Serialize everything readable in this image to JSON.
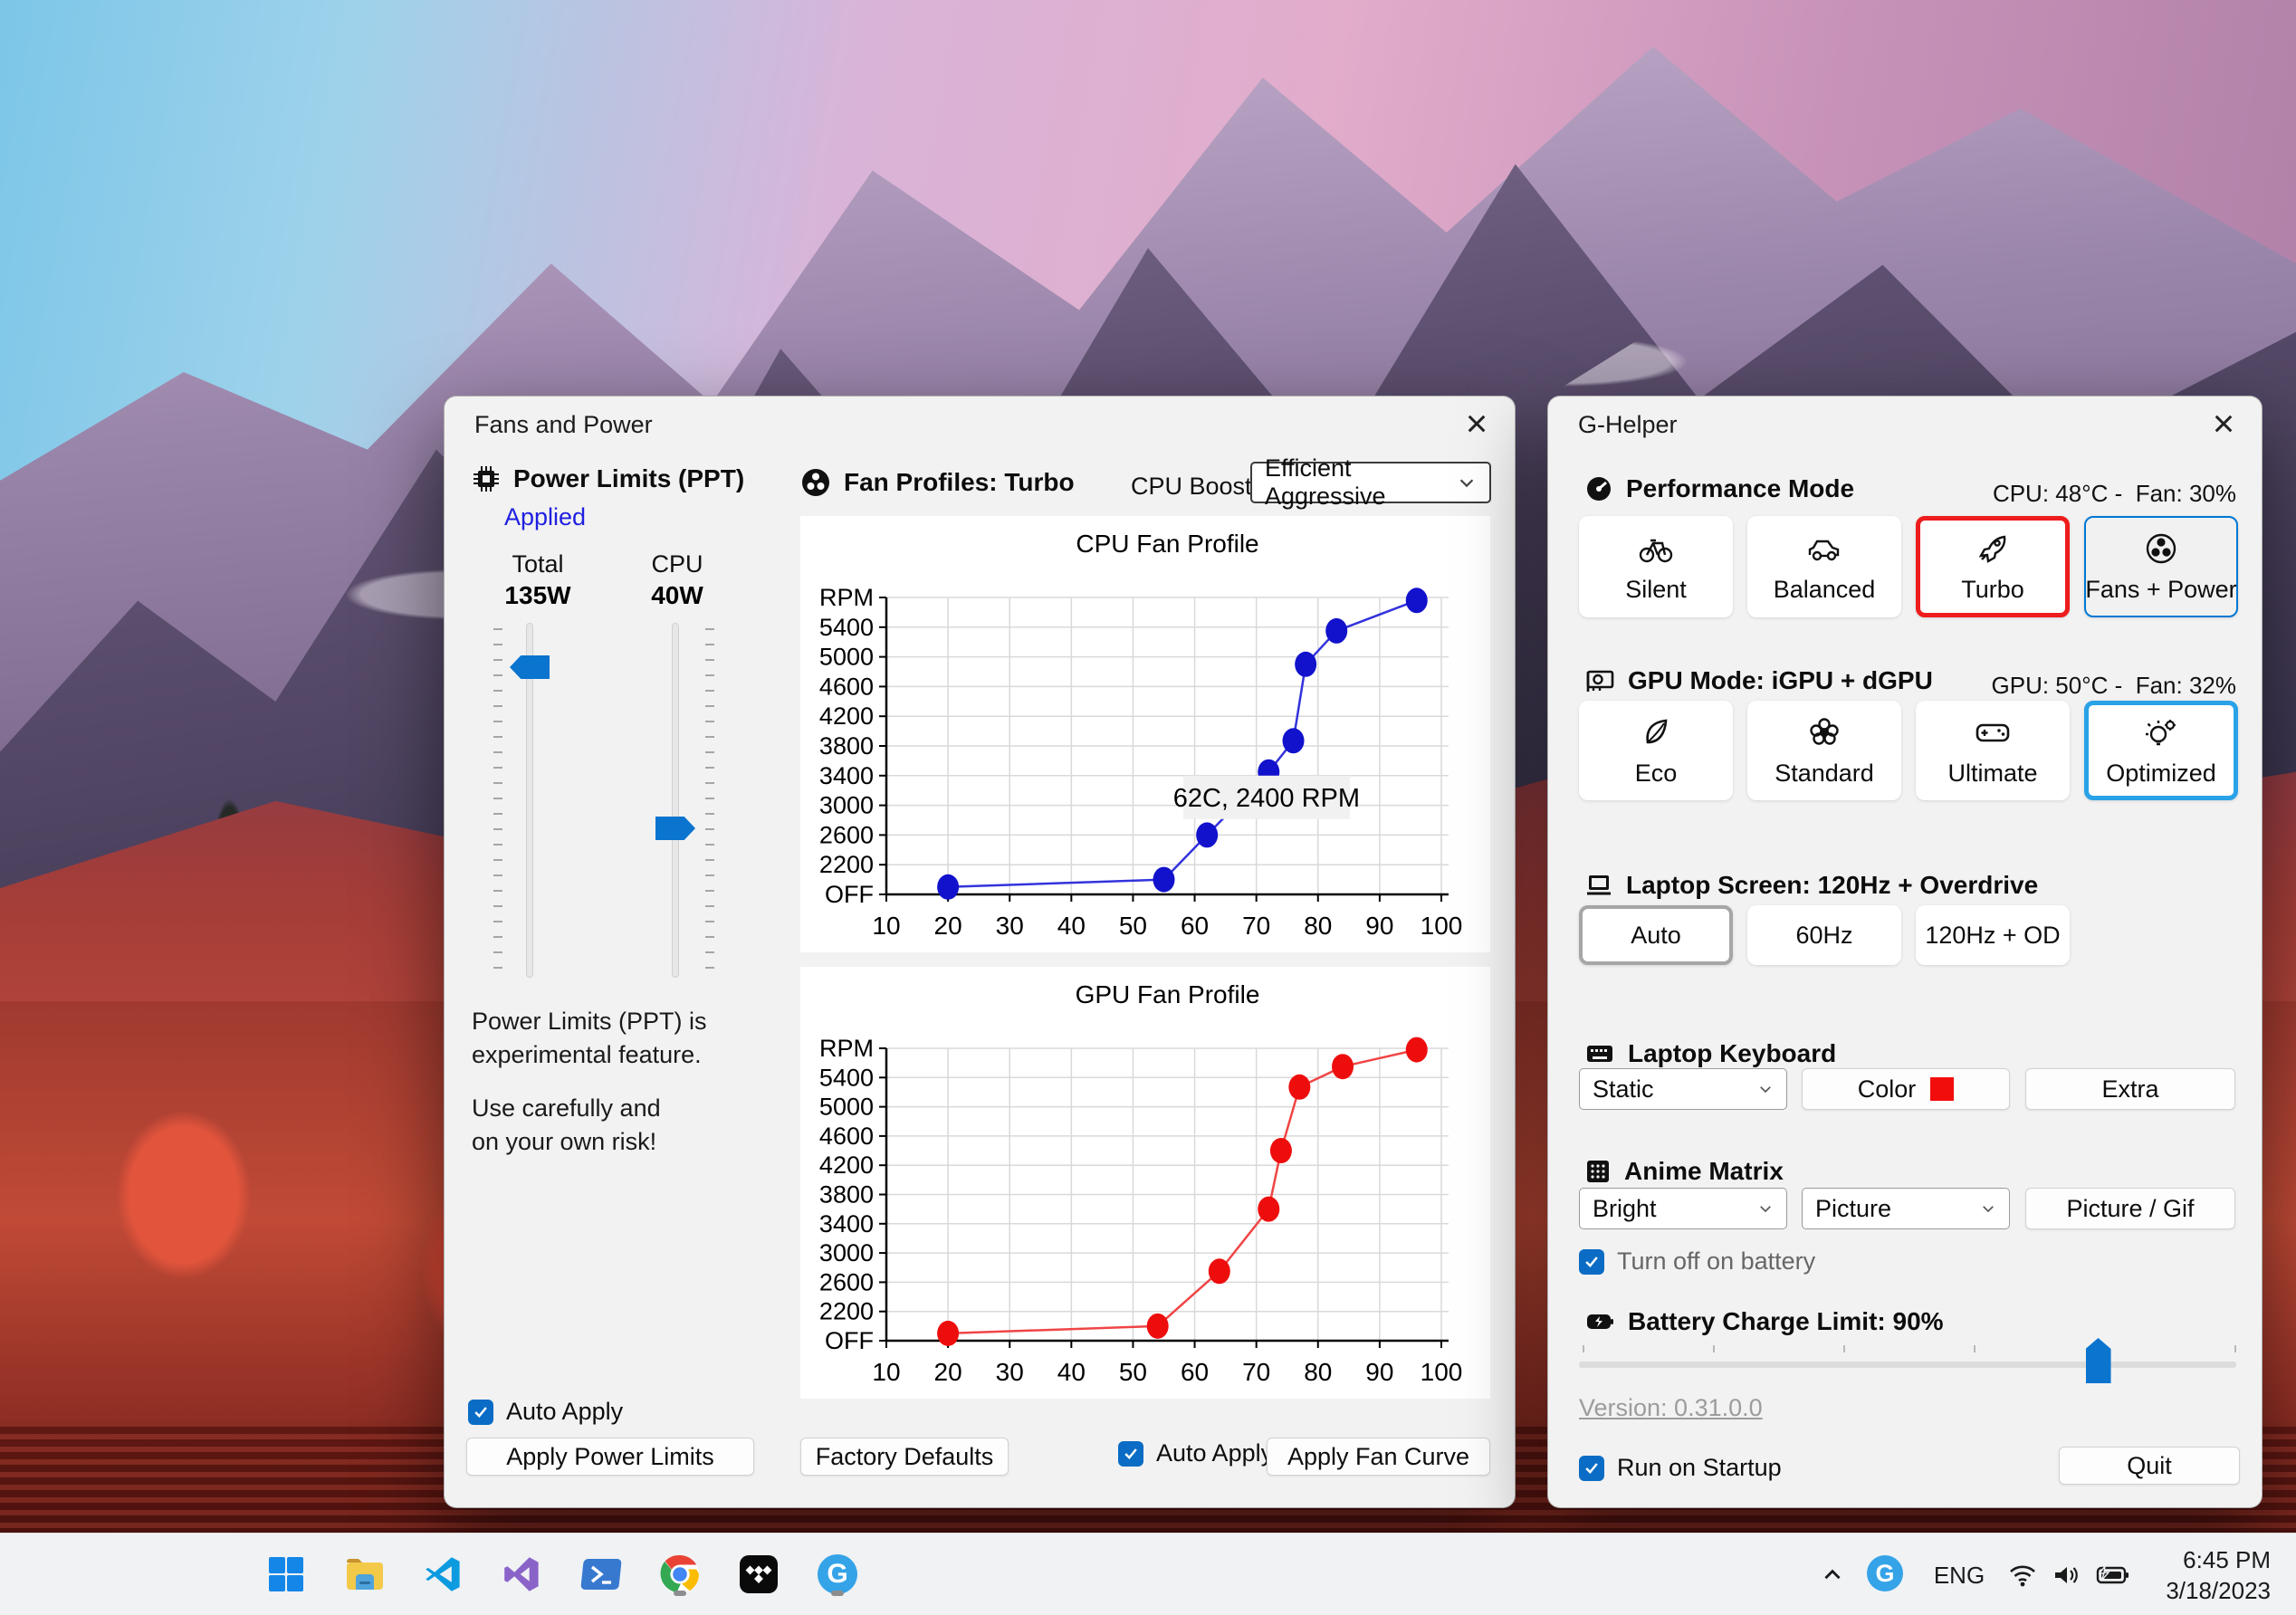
{
  "fans_window": {
    "title": "Fans and Power",
    "close_label": "×",
    "power_limits": {
      "header": "Power Limits (PPT)",
      "status": "Applied",
      "columns": [
        {
          "label": "Total",
          "value": "135W"
        },
        {
          "label": "CPU",
          "value": "40W"
        }
      ],
      "warning_line1": "Power Limits (PPT) is",
      "warning_line2": "experimental feature.",
      "warning_line3": "Use carefully and",
      "warning_line4": "on your own risk!",
      "auto_apply_label": "Auto Apply",
      "apply_button": "Apply Power Limits"
    },
    "fan_profiles": {
      "header": "Fan Profiles: Turbo",
      "cpu_boost_label": "CPU Boost",
      "cpu_boost_value": "Efficient Aggressive",
      "factory_defaults_button": "Factory Defaults",
      "auto_apply_label": "Auto Apply",
      "apply_fan_curve_button": "Apply Fan Curve"
    }
  },
  "chart_data": [
    {
      "type": "line",
      "title": "CPU Fan Profile",
      "x": [
        20,
        55,
        62,
        72,
        76,
        78,
        83,
        96
      ],
      "y": [
        1900,
        2000,
        2600,
        3450,
        3870,
        4900,
        5350,
        5760
      ],
      "xticks": [
        10,
        20,
        30,
        40,
        50,
        60,
        70,
        80,
        90,
        100
      ],
      "ytick_values": [
        1800,
        2200,
        2600,
        3000,
        3400,
        3800,
        4200,
        4600,
        5000,
        5400,
        5800
      ],
      "ytick_labels": [
        "OFF",
        "2200",
        "2600",
        "3000",
        "3400",
        "3800",
        "4200",
        "4600",
        "5000",
        "5400",
        "RPM"
      ],
      "xlim": [
        10,
        104
      ],
      "ylim": [
        1800,
        5800
      ],
      "grid": true,
      "legend": "none",
      "line_color": "#3333dd",
      "point_color": "#1212cc",
      "tooltip": "62C, 2400 RPM"
    },
    {
      "type": "line",
      "title": "GPU Fan Profile",
      "x": [
        20,
        54,
        64,
        72,
        74,
        77,
        84,
        96
      ],
      "y": [
        1900,
        2000,
        2750,
        3600,
        4400,
        5270,
        5550,
        5780
      ],
      "xticks": [
        10,
        20,
        30,
        40,
        50,
        60,
        70,
        80,
        90,
        100
      ],
      "ytick_values": [
        1800,
        2200,
        2600,
        3000,
        3400,
        3800,
        4200,
        4600,
        5000,
        5400,
        5800
      ],
      "ytick_labels": [
        "OFF",
        "2200",
        "2600",
        "3000",
        "3400",
        "3800",
        "4200",
        "4600",
        "5000",
        "5400",
        "RPM"
      ],
      "xlim": [
        10,
        104
      ],
      "ylim": [
        1800,
        5800
      ],
      "grid": true,
      "legend": "none",
      "line_color": "#f04545",
      "point_color": "#ee0d0d",
      "tooltip": ""
    }
  ],
  "ghelper_window": {
    "title": "G-Helper",
    "close_label": "×",
    "performance": {
      "header": "Performance Mode",
      "status": "CPU: 48°C -  Fan: 30%",
      "active_border_color": "#ee1c1c",
      "buttons": [
        {
          "label": "Silent",
          "icon": "bicycle-icon"
        },
        {
          "label": "Balanced",
          "icon": "car-icon"
        },
        {
          "label": "Turbo",
          "icon": "rocket-icon"
        },
        {
          "label": "Fans + Power",
          "icon": "fan-icon"
        }
      ]
    },
    "gpu_mode": {
      "header": "GPU Mode: iGPU + dGPU",
      "status": "GPU: 50°C -  Fan: 32%",
      "selected_border_color": "#2aa2e8",
      "buttons": [
        {
          "label": "Eco",
          "icon": "leaf-icon"
        },
        {
          "label": "Standard",
          "icon": "flower-icon"
        },
        {
          "label": "Ultimate",
          "icon": "gamepad-icon"
        },
        {
          "label": "Optimized",
          "icon": "bulb-gear-icon"
        }
      ]
    },
    "screen": {
      "header": "Laptop Screen: 120Hz + Overdrive",
      "buttons": [
        {
          "label": "Auto"
        },
        {
          "label": "60Hz"
        },
        {
          "label": "120Hz + OD"
        }
      ]
    },
    "keyboard": {
      "header": "Laptop Keyboard",
      "mode_value": "Static",
      "color_button": "Color",
      "color_swatch": "#f20d0d",
      "extra_button": "Extra"
    },
    "anime_matrix": {
      "header": "Anime Matrix",
      "brightness_value": "Bright",
      "mode_value": "Picture",
      "picture_button": "Picture / Gif",
      "battery_checkbox_label": "Turn off on battery"
    },
    "battery": {
      "header": "Battery Charge Limit: 90%",
      "slider_fraction": 0.79
    },
    "version_link": "Version: 0.31.0.0",
    "run_on_startup_label": "Run on Startup",
    "quit_button": "Quit"
  },
  "taskbar": {
    "icons": [
      "start",
      "file-explorer",
      "vscode",
      "visual-studio",
      "powershell",
      "chrome",
      "tidal",
      "g-helper"
    ],
    "running_indicators": [
      "chrome",
      "g-helper"
    ],
    "tray": {
      "language": "ENG",
      "time": "6:45 PM",
      "date": "3/18/2023"
    }
  }
}
